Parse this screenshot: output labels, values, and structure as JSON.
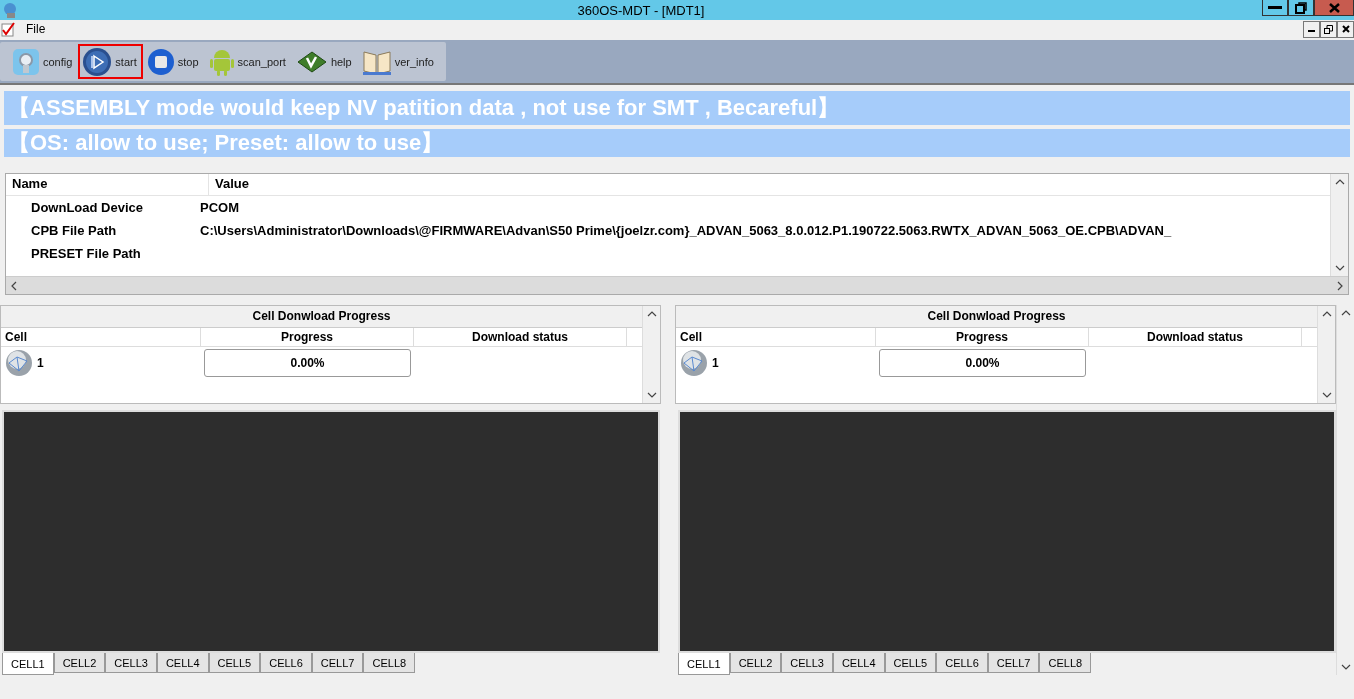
{
  "window": {
    "title": "360OS-MDT - [MDT1]"
  },
  "menu": [
    {
      "label": "File"
    }
  ],
  "toolbar": [
    {
      "label": "config",
      "highlighted": false
    },
    {
      "label": "start",
      "highlighted": true
    },
    {
      "label": "stop",
      "highlighted": false
    },
    {
      "label": "scan_port",
      "highlighted": false
    },
    {
      "label": "help",
      "highlighted": false
    },
    {
      "label": "ver_info",
      "highlighted": false
    }
  ],
  "banners": [
    "【ASSEMBLY mode would keep NV patition data , not use for SMT , Becareful】",
    "【OS: allow to use; Preset: allow to use】"
  ],
  "info_table": {
    "columns": [
      "Name",
      "Value"
    ],
    "rows": [
      {
        "name": "DownLoad Device",
        "value": "PCOM"
      },
      {
        "name": "CPB File Path",
        "value": "C:\\Users\\Administrator\\Downloads\\@FIRMWARE\\Advan\\S50 Prime\\{joelzr.com}_ADVAN_5063_8.0.012.P1.190722.5063.RWTX_ADVAN_5063_OE.CPB\\ADVAN_"
      },
      {
        "name": "PRESET File Path"
      }
    ]
  },
  "cell_panels": [
    {
      "title": "Cell Donwload Progress",
      "columns": [
        "Cell",
        "Progress",
        "Download status"
      ],
      "rows": [
        {
          "cell": "1",
          "progress": "0.00%",
          "level": 0
        }
      ],
      "tabs": [
        {
          "label": "CELL1",
          "selected": true
        },
        {
          "label": "CELL2",
          "selected": false
        },
        {
          "label": "CELL3",
          "selected": false
        },
        {
          "label": "CELL4",
          "selected": false
        },
        {
          "label": "CELL5",
          "selected": false
        },
        {
          "label": "CELL6",
          "selected": false
        },
        {
          "label": "CELL7",
          "selected": false
        },
        {
          "label": "CELL8",
          "selected": false
        }
      ]
    },
    {
      "title": "Cell Donwload Progress",
      "columns": [
        "Cell",
        "Progress",
        "Download status"
      ],
      "rows": [
        {
          "cell": "1",
          "progress": "0.00%",
          "level": 0
        }
      ],
      "tabs": [
        {
          "label": "CELL1",
          "selected": true
        },
        {
          "label": "CELL2",
          "selected": false
        },
        {
          "label": "CELL3",
          "selected": false
        },
        {
          "label": "CELL4",
          "selected": false
        },
        {
          "label": "CELL5",
          "selected": false
        },
        {
          "label": "CELL6",
          "selected": false
        },
        {
          "label": "CELL7",
          "selected": false
        },
        {
          "label": "CELL8",
          "selected": false
        }
      ]
    }
  ]
}
